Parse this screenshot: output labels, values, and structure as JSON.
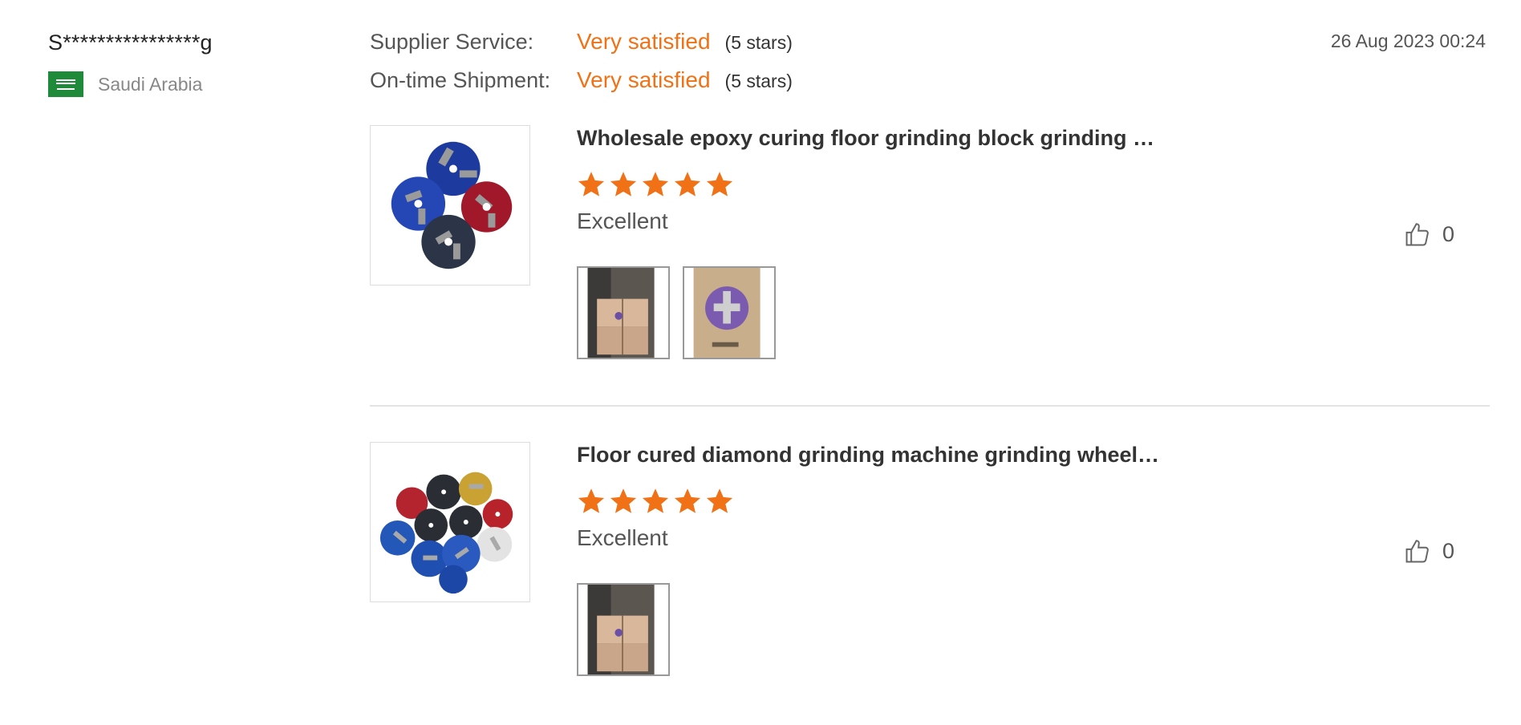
{
  "reviewer": {
    "name": "S****************g",
    "country": "Saudi Arabia",
    "flag_icon": "saudi-arabia-flag-icon"
  },
  "ratings": [
    {
      "label": "Supplier Service:",
      "value": "Very satisfied",
      "stars_text": "(5 stars)"
    },
    {
      "label": "On-time Shipment:",
      "value": "Very satisfied",
      "stars_text": "(5 stars)"
    }
  ],
  "date": "26 Aug 2023 00:24",
  "colors": {
    "accent": "#f07116",
    "text": "#333333",
    "muted": "#888888",
    "divider": "#e3e3e3"
  },
  "products": [
    {
      "title": "Wholesale epoxy curing floor grinding block grinding …",
      "rating": 5,
      "review": "Excellent",
      "likes": "0",
      "photo_count": 2
    },
    {
      "title": "Floor cured diamond grinding machine grinding wheel…",
      "rating": 5,
      "review": "Excellent",
      "likes": "0",
      "photo_count": 1
    }
  ]
}
